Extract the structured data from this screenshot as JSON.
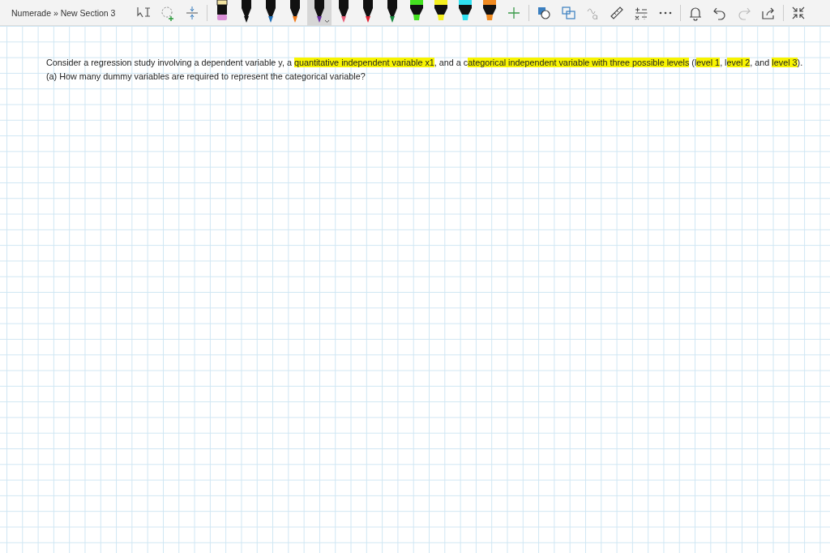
{
  "breadcrumb": "Numerade » New Section 3",
  "pens": [
    {
      "kind": "eraser",
      "color": "#d98fd6",
      "selected": false
    },
    {
      "kind": "pen",
      "color": "#111111",
      "selected": false
    },
    {
      "kind": "pen",
      "color": "#1e6fb8",
      "selected": false
    },
    {
      "kind": "pen",
      "color": "#f07a1a",
      "selected": false
    },
    {
      "kind": "pen",
      "color": "#6a2fa0",
      "selected": true
    },
    {
      "kind": "pen",
      "color": "#e8607a",
      "selected": false
    },
    {
      "kind": "pen",
      "color": "#e02030",
      "selected": false
    },
    {
      "kind": "pen",
      "color": "#1a8a40",
      "selected": false
    },
    {
      "kind": "highlighter",
      "color": "#44e020",
      "selected": false
    },
    {
      "kind": "highlighter",
      "color": "#f5f020",
      "selected": false
    },
    {
      "kind": "highlighter",
      "color": "#30e0f0",
      "selected": false
    },
    {
      "kind": "highlighter",
      "color": "#f08a20",
      "selected": false
    }
  ],
  "question": {
    "lines": [
      [
        {
          "text": "Consider a regression study involving a dependent variable y, a ",
          "highlighted": false
        },
        {
          "text": "quantitative independent variable x1",
          "highlighted": true
        },
        {
          "text": ", and a c",
          "highlighted": false
        },
        {
          "text": "ategorical independent variable with three possible levels",
          "highlighted": true
        },
        {
          "text": " (l",
          "highlighted": false
        },
        {
          "text": "evel 1",
          "highlighted": true
        },
        {
          "text": ", l",
          "highlighted": false
        },
        {
          "text": "evel 2",
          "highlighted": true
        },
        {
          "text": ", and ",
          "highlighted": false
        },
        {
          "text": "level 3",
          "highlighted": true
        },
        {
          "text": ").",
          "highlighted": false
        }
      ],
      [
        {
          "text": "(a) How many dummy variables are required to represent the categorical variable?",
          "highlighted": false
        }
      ]
    ]
  }
}
